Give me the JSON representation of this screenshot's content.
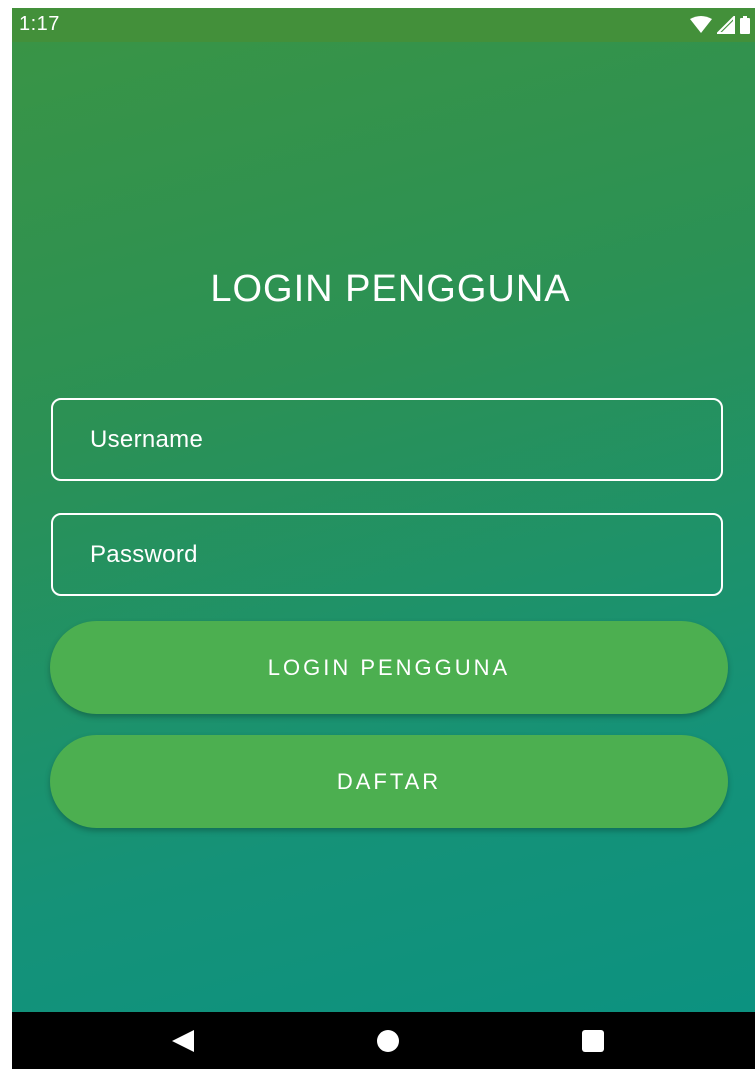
{
  "status_bar": {
    "time": "1:17",
    "icons": [
      "wifi-icon",
      "signal-icon",
      "battery-icon"
    ]
  },
  "screen": {
    "title": "LOGIN PENGGUNA",
    "username": {
      "placeholder": "Username",
      "value": ""
    },
    "password": {
      "placeholder": "Password",
      "value": ""
    },
    "login_button": "LOGIN PENGGUNA",
    "register_button": "DAFTAR"
  },
  "nav_bar": {
    "icons": [
      "back-icon",
      "home-icon",
      "recents-icon"
    ]
  },
  "colors": {
    "status_bar": "#43903a",
    "gradient_top": "#399446",
    "gradient_bottom": "#0c9280",
    "button": "#4caf50",
    "text": "#ffffff",
    "nav_bar": "#000000"
  }
}
